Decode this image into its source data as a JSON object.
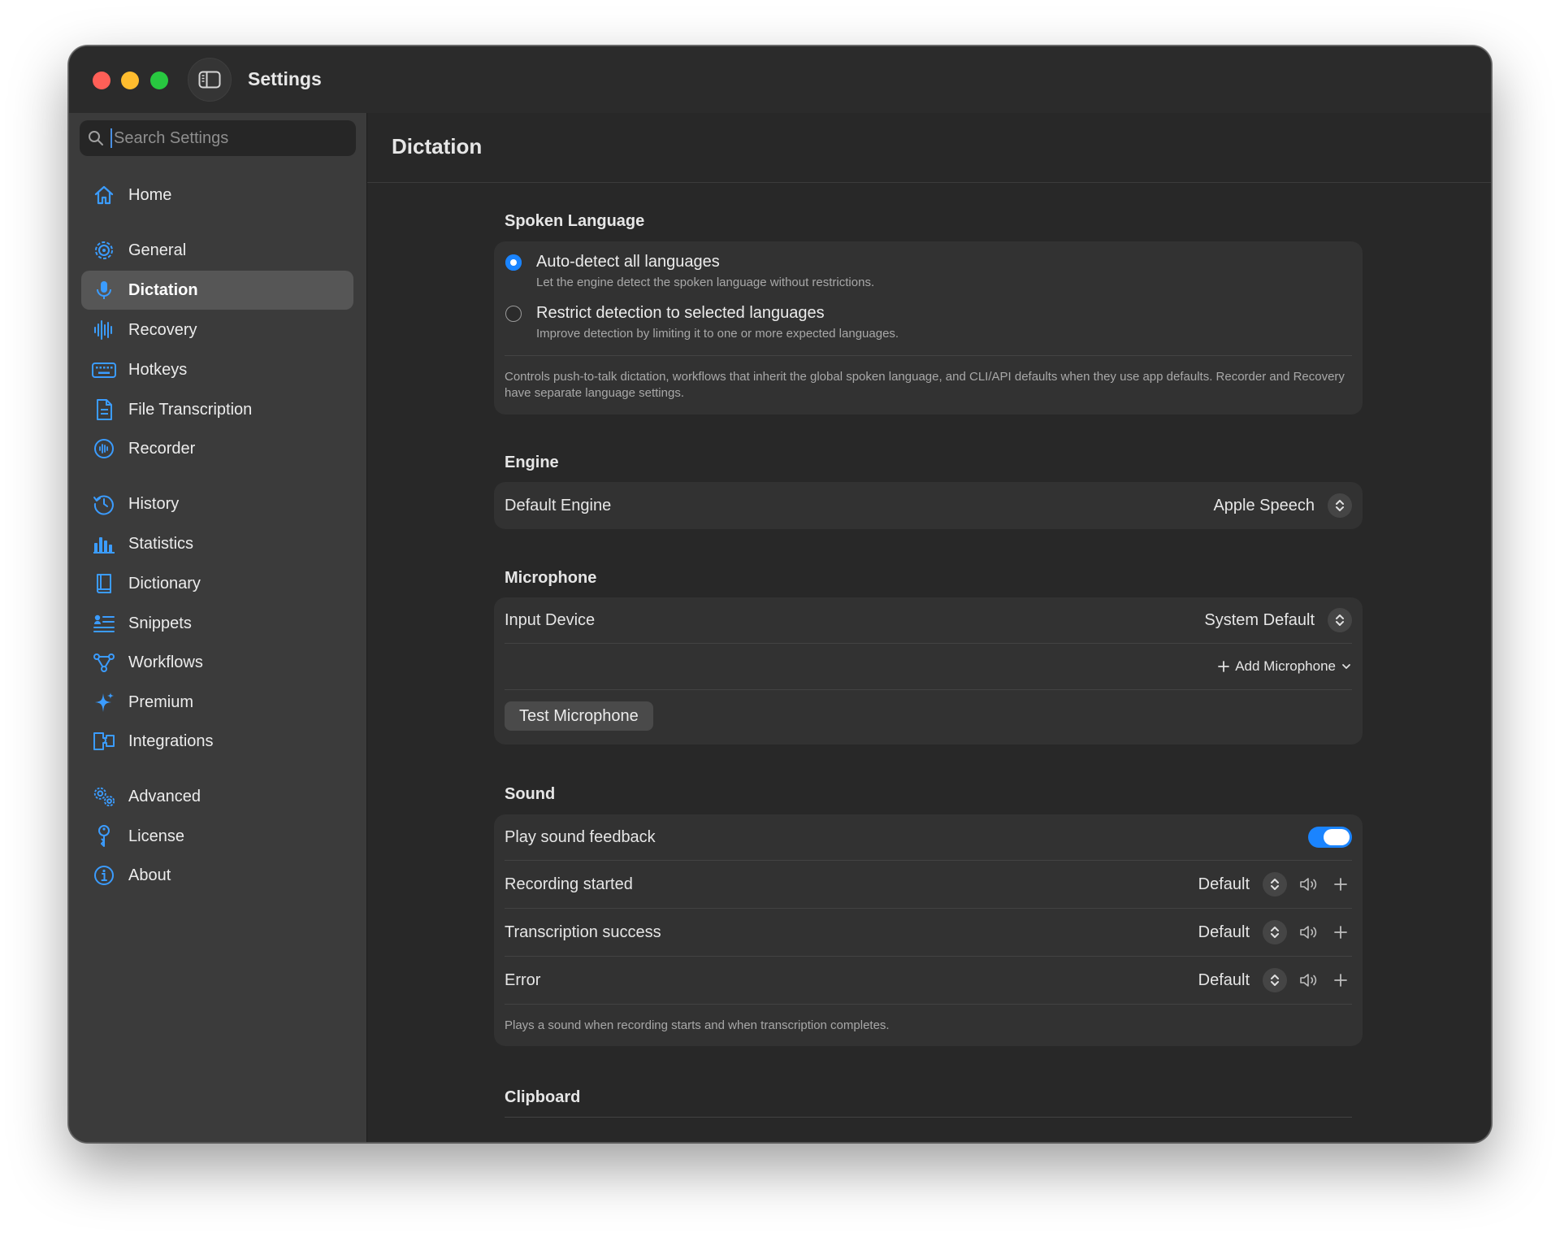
{
  "window": {
    "title": "Settings"
  },
  "search": {
    "placeholder": "Search Settings",
    "value": ""
  },
  "sidebar": {
    "items": [
      {
        "label": "Home",
        "icon": "house-icon"
      },
      {
        "label": "General",
        "icon": "gear-icon"
      },
      {
        "label": "Dictation",
        "icon": "microphone-icon",
        "active": true
      },
      {
        "label": "Recovery",
        "icon": "waveform-icon"
      },
      {
        "label": "Hotkeys",
        "icon": "keyboard-icon"
      },
      {
        "label": "File Transcription",
        "icon": "document-icon"
      },
      {
        "label": "Recorder",
        "icon": "recorder-icon"
      },
      {
        "label": "History",
        "icon": "clock-history-icon"
      },
      {
        "label": "Statistics",
        "icon": "bar-chart-icon"
      },
      {
        "label": "Dictionary",
        "icon": "book-icon"
      },
      {
        "label": "Snippets",
        "icon": "snippets-icon"
      },
      {
        "label": "Workflows",
        "icon": "workflow-icon"
      },
      {
        "label": "Premium",
        "icon": "sparkle-icon"
      },
      {
        "label": "Integrations",
        "icon": "integrations-icon"
      },
      {
        "label": "Advanced",
        "icon": "gears-icon"
      },
      {
        "label": "License",
        "icon": "key-icon"
      },
      {
        "label": "About",
        "icon": "info-icon"
      }
    ]
  },
  "main": {
    "title": "Dictation",
    "spoken_language": {
      "title": "Spoken Language",
      "options": [
        {
          "title": "Auto-detect all languages",
          "description": "Let the engine detect the spoken language without restrictions.",
          "selected": true
        },
        {
          "title": "Restrict detection to selected languages",
          "description": "Improve detection by limiting it to one or more expected languages.",
          "selected": false
        }
      ],
      "footnote": "Controls push-to-talk dictation, workflows that inherit the global spoken language, and CLI/API defaults when they use app defaults. Recorder and Recovery have separate language settings."
    },
    "engine": {
      "title": "Engine",
      "default_label": "Default Engine",
      "default_value": "Apple Speech"
    },
    "microphone": {
      "title": "Microphone",
      "input_label": "Input Device",
      "input_value": "System Default",
      "add_label": "Add Microphone",
      "test_label": "Test Microphone"
    },
    "sound": {
      "title": "Sound",
      "feedback_label": "Play sound feedback",
      "feedback_on": true,
      "rows": [
        {
          "label": "Recording started",
          "value": "Default"
        },
        {
          "label": "Transcription success",
          "value": "Default"
        },
        {
          "label": "Error",
          "value": "Default"
        }
      ],
      "footnote": "Plays a sound when recording starts and when transcription completes."
    },
    "clipboard": {
      "title": "Clipboard"
    }
  },
  "colors": {
    "accent": "#1a84ff",
    "icon_blue": "#3b9cff",
    "close": "#ff5f57",
    "minimize": "#febc2e",
    "maximize": "#28c840"
  }
}
